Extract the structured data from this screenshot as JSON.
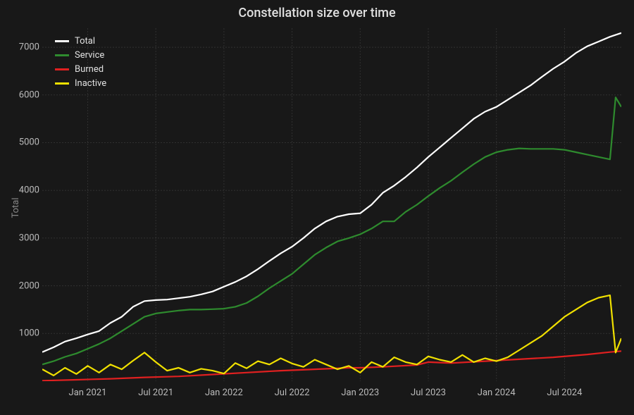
{
  "chart_data": {
    "type": "line",
    "title": "Constellation size over time",
    "xlabel": "",
    "ylabel": "Total",
    "ylim": [
      0,
      7400
    ],
    "y_ticks": [
      1000,
      2000,
      3000,
      4000,
      5000,
      6000,
      7000
    ],
    "x_ticks": [
      "Jan 2021",
      "Jul 2021",
      "Jan 2022",
      "Jul 2022",
      "Jan 2023",
      "Jul 2023",
      "Jan 2024",
      "Jul 2024"
    ],
    "x_range_months": [
      "2020-09",
      "2024-12"
    ],
    "legend": [
      {
        "name": "Total",
        "color": "#ffffff"
      },
      {
        "name": "Service",
        "color": "#2e8b2e"
      },
      {
        "name": "Burned",
        "color": "#e02020"
      },
      {
        "name": "Inactive",
        "color": "#f0e000"
      }
    ],
    "series": [
      {
        "name": "Total",
        "color": "#ffffff",
        "points": [
          [
            "2020-09",
            610
          ],
          [
            "2020-10",
            710
          ],
          [
            "2020-11",
            830
          ],
          [
            "2020-12",
            900
          ],
          [
            "2021-01",
            980
          ],
          [
            "2021-02",
            1050
          ],
          [
            "2021-03",
            1220
          ],
          [
            "2021-04",
            1350
          ],
          [
            "2021-05",
            1560
          ],
          [
            "2021-06",
            1680
          ],
          [
            "2021-07",
            1700
          ],
          [
            "2021-08",
            1710
          ],
          [
            "2021-09",
            1740
          ],
          [
            "2021-10",
            1770
          ],
          [
            "2021-11",
            1820
          ],
          [
            "2021-12",
            1880
          ],
          [
            "2022-01",
            1980
          ],
          [
            "2022-02",
            2080
          ],
          [
            "2022-03",
            2200
          ],
          [
            "2022-04",
            2350
          ],
          [
            "2022-05",
            2520
          ],
          [
            "2022-06",
            2680
          ],
          [
            "2022-07",
            2820
          ],
          [
            "2022-08",
            3000
          ],
          [
            "2022-09",
            3200
          ],
          [
            "2022-10",
            3350
          ],
          [
            "2022-11",
            3450
          ],
          [
            "2022-12",
            3500
          ],
          [
            "2023-01",
            3520
          ],
          [
            "2023-02",
            3700
          ],
          [
            "2023-03",
            3950
          ],
          [
            "2023-04",
            4100
          ],
          [
            "2023-05",
            4280
          ],
          [
            "2023-06",
            4480
          ],
          [
            "2023-07",
            4700
          ],
          [
            "2023-08",
            4900
          ],
          [
            "2023-09",
            5100
          ],
          [
            "2023-10",
            5300
          ],
          [
            "2023-11",
            5500
          ],
          [
            "2023-12",
            5650
          ],
          [
            "2024-01",
            5750
          ],
          [
            "2024-02",
            5900
          ],
          [
            "2024-03",
            6050
          ],
          [
            "2024-04",
            6200
          ],
          [
            "2024-05",
            6380
          ],
          [
            "2024-06",
            6550
          ],
          [
            "2024-07",
            6700
          ],
          [
            "2024-08",
            6880
          ],
          [
            "2024-09",
            7020
          ],
          [
            "2024-10",
            7120
          ],
          [
            "2024-11",
            7220
          ],
          [
            "2024-12",
            7300
          ]
        ]
      },
      {
        "name": "Service",
        "color": "#2e8b2e",
        "points": [
          [
            "2020-09",
            350
          ],
          [
            "2020-10",
            420
          ],
          [
            "2020-11",
            510
          ],
          [
            "2020-12",
            580
          ],
          [
            "2021-01",
            680
          ],
          [
            "2021-02",
            780
          ],
          [
            "2021-03",
            900
          ],
          [
            "2021-04",
            1050
          ],
          [
            "2021-05",
            1200
          ],
          [
            "2021-06",
            1350
          ],
          [
            "2021-07",
            1420
          ],
          [
            "2021-08",
            1450
          ],
          [
            "2021-09",
            1480
          ],
          [
            "2021-10",
            1500
          ],
          [
            "2021-11",
            1500
          ],
          [
            "2021-12",
            1510
          ],
          [
            "2022-01",
            1520
          ],
          [
            "2022-02",
            1560
          ],
          [
            "2022-03",
            1640
          ],
          [
            "2022-04",
            1780
          ],
          [
            "2022-05",
            1950
          ],
          [
            "2022-06",
            2100
          ],
          [
            "2022-07",
            2250
          ],
          [
            "2022-08",
            2450
          ],
          [
            "2022-09",
            2650
          ],
          [
            "2022-10",
            2800
          ],
          [
            "2022-11",
            2930
          ],
          [
            "2022-12",
            3000
          ],
          [
            "2023-01",
            3080
          ],
          [
            "2023-02",
            3200
          ],
          [
            "2023-03",
            3350
          ],
          [
            "2023-04",
            3350
          ],
          [
            "2023-05",
            3550
          ],
          [
            "2023-06",
            3700
          ],
          [
            "2023-07",
            3880
          ],
          [
            "2023-08",
            4050
          ],
          [
            "2023-09",
            4200
          ],
          [
            "2023-10",
            4380
          ],
          [
            "2023-11",
            4550
          ],
          [
            "2023-12",
            4700
          ],
          [
            "2024-01",
            4800
          ],
          [
            "2024-02",
            4850
          ],
          [
            "2024-03",
            4880
          ],
          [
            "2024-04",
            4870
          ],
          [
            "2024-05",
            4870
          ],
          [
            "2024-06",
            4870
          ],
          [
            "2024-07",
            4850
          ],
          [
            "2024-08",
            4800
          ],
          [
            "2024-09",
            4750
          ],
          [
            "2024-10",
            4700
          ],
          [
            "2024-11",
            4650
          ],
          [
            "2024-11.5",
            5950
          ],
          [
            "2024-12",
            5750
          ]
        ]
      },
      {
        "name": "Burned",
        "color": "#e02020",
        "points": [
          [
            "2020-09",
            10
          ],
          [
            "2020-12",
            30
          ],
          [
            "2021-03",
            50
          ],
          [
            "2021-06",
            80
          ],
          [
            "2021-09",
            100
          ],
          [
            "2021-12",
            140
          ],
          [
            "2022-03",
            180
          ],
          [
            "2022-06",
            220
          ],
          [
            "2022-09",
            250
          ],
          [
            "2022-12",
            280
          ],
          [
            "2023-01",
            280
          ],
          [
            "2023-03",
            300
          ],
          [
            "2023-06",
            340
          ],
          [
            "2023-07",
            400
          ],
          [
            "2023-09",
            380
          ],
          [
            "2023-12",
            420
          ],
          [
            "2024-03",
            460
          ],
          [
            "2024-06",
            500
          ],
          [
            "2024-09",
            560
          ],
          [
            "2024-11",
            610
          ],
          [
            "2024-12",
            630
          ]
        ]
      },
      {
        "name": "Inactive",
        "color": "#f0e000",
        "points": [
          [
            "2020-09",
            250
          ],
          [
            "2020-10",
            120
          ],
          [
            "2020-11",
            280
          ],
          [
            "2020-12",
            150
          ],
          [
            "2021-01",
            320
          ],
          [
            "2021-02",
            180
          ],
          [
            "2021-03",
            350
          ],
          [
            "2021-04",
            250
          ],
          [
            "2021-05",
            430
          ],
          [
            "2021-06",
            600
          ],
          [
            "2021-07",
            400
          ],
          [
            "2021-08",
            220
          ],
          [
            "2021-09",
            280
          ],
          [
            "2021-10",
            180
          ],
          [
            "2021-11",
            260
          ],
          [
            "2021-12",
            220
          ],
          [
            "2022-01",
            160
          ],
          [
            "2022-02",
            380
          ],
          [
            "2022-03",
            270
          ],
          [
            "2022-04",
            420
          ],
          [
            "2022-05",
            350
          ],
          [
            "2022-06",
            480
          ],
          [
            "2022-07",
            370
          ],
          [
            "2022-08",
            300
          ],
          [
            "2022-09",
            450
          ],
          [
            "2022-10",
            350
          ],
          [
            "2022-11",
            250
          ],
          [
            "2022-12",
            320
          ],
          [
            "2023-01",
            180
          ],
          [
            "2023-02",
            400
          ],
          [
            "2023-03",
            300
          ],
          [
            "2023-04",
            500
          ],
          [
            "2023-05",
            400
          ],
          [
            "2023-06",
            350
          ],
          [
            "2023-07",
            520
          ],
          [
            "2023-08",
            450
          ],
          [
            "2023-09",
            400
          ],
          [
            "2023-10",
            550
          ],
          [
            "2023-11",
            400
          ],
          [
            "2023-12",
            480
          ],
          [
            "2024-01",
            420
          ],
          [
            "2024-02",
            500
          ],
          [
            "2024-03",
            650
          ],
          [
            "2024-04",
            800
          ],
          [
            "2024-05",
            950
          ],
          [
            "2024-06",
            1150
          ],
          [
            "2024-07",
            1350
          ],
          [
            "2024-08",
            1500
          ],
          [
            "2024-09",
            1650
          ],
          [
            "2024-10",
            1750
          ],
          [
            "2024-11",
            1800
          ],
          [
            "2024-11.5",
            600
          ],
          [
            "2024-12",
            900
          ]
        ]
      }
    ]
  }
}
